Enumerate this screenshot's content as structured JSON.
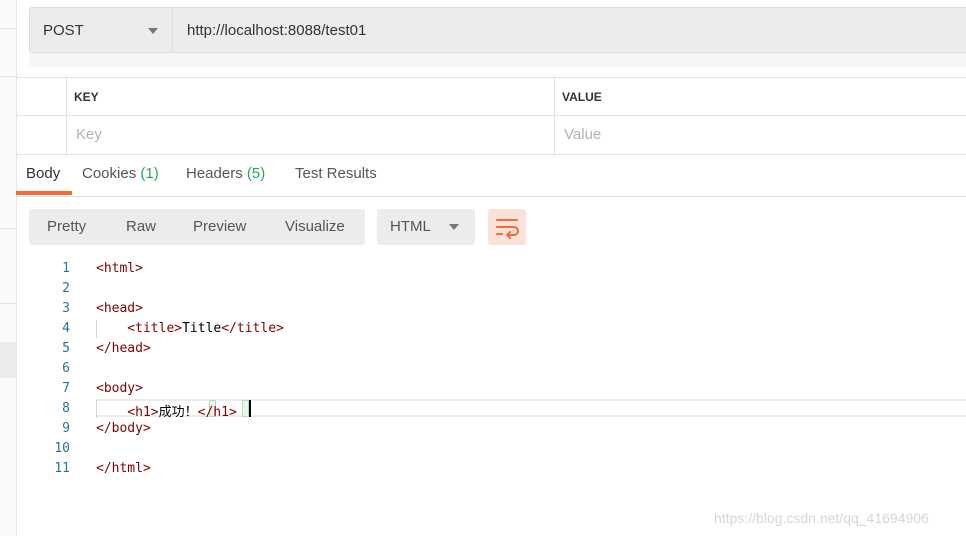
{
  "request": {
    "method": "POST",
    "url": "http://localhost:8088/test01"
  },
  "params": {
    "key_header": "KEY",
    "value_header": "VALUE",
    "key_placeholder": "Key",
    "value_placeholder": "Value"
  },
  "response_tabs": [
    {
      "label": "Body",
      "count": ""
    },
    {
      "label": "Cookies",
      "count": "(1)"
    },
    {
      "label": "Headers",
      "count": "(5)"
    },
    {
      "label": "Test Results",
      "count": ""
    }
  ],
  "view_modes": [
    "Pretty",
    "Raw",
    "Preview",
    "Visualize"
  ],
  "language": "HTML",
  "code_lines": [
    {
      "n": "1",
      "text": "<html>"
    },
    {
      "n": "2",
      "text": ""
    },
    {
      "n": "3",
      "text": "<head>"
    },
    {
      "n": "4",
      "text": "    <title>",
      "inner": "Title",
      "close": "</title>"
    },
    {
      "n": "5",
      "text": "</head>"
    },
    {
      "n": "6",
      "text": ""
    },
    {
      "n": "7",
      "text": "<body>"
    },
    {
      "n": "8",
      "text": "    <h1>",
      "inner": "成功！",
      "close": "</h1>"
    },
    {
      "n": "9",
      "text": "</body>"
    },
    {
      "n": "10",
      "text": ""
    },
    {
      "n": "11",
      "text": "</html>"
    }
  ],
  "watermark": "https://blog.csdn.net/qq_41694906",
  "colors": {
    "accent": "#f26b3a",
    "count_green": "#26a65b",
    "line_number": "#237893",
    "tag": "#800000"
  }
}
